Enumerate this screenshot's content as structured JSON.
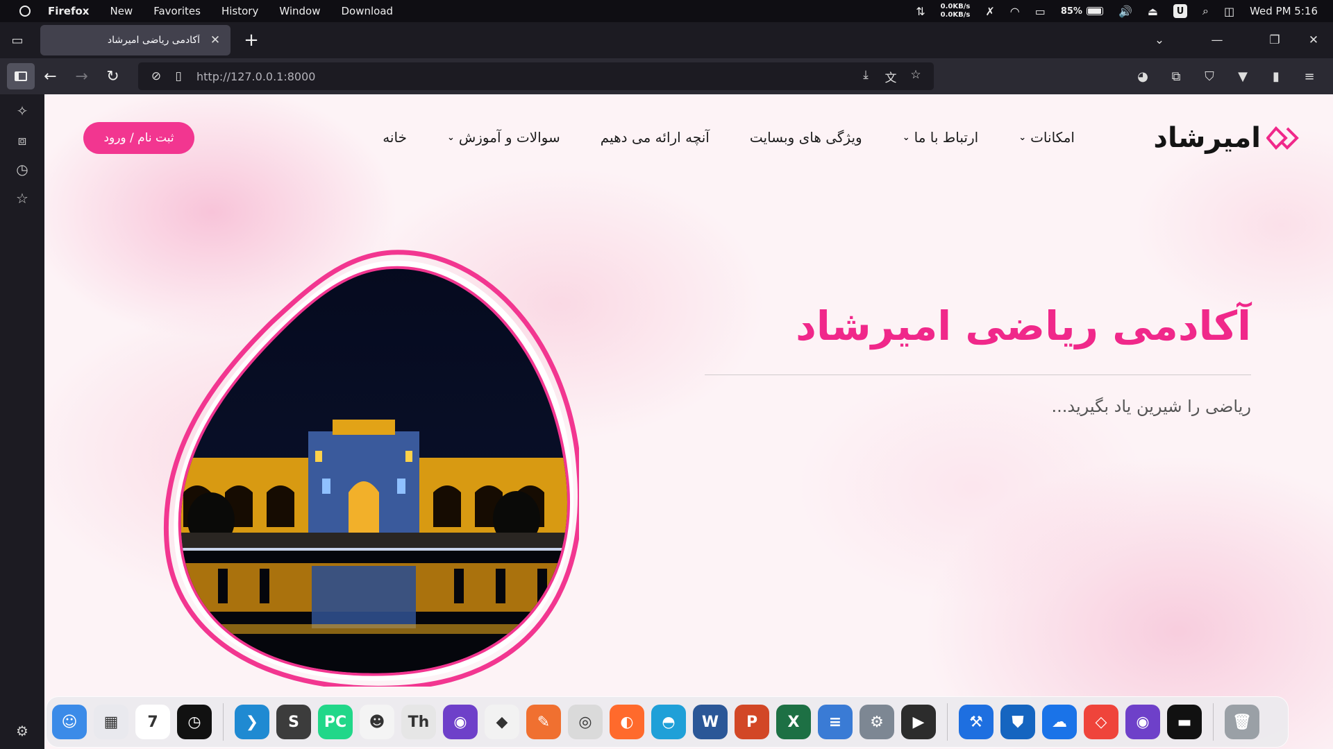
{
  "menubar": {
    "app_name": "Firefox",
    "items": [
      "New",
      "Favorites",
      "History",
      "Window",
      "Download"
    ],
    "net_up": "0.0KB/s",
    "net_down": "0.0KB/s",
    "battery": "85%",
    "u_badge": "U",
    "clock": "Wed PM 5:16"
  },
  "tab": {
    "title": "آکادمی ریاضی امیرشاد",
    "close": "✕"
  },
  "urlbar": {
    "url": "http://127.0.0.1:8000"
  },
  "site": {
    "brand": "امیرشاد",
    "nav": [
      {
        "label": "خانه",
        "dropdown": false
      },
      {
        "label": "سوالات و آموزش",
        "dropdown": true
      },
      {
        "label": "آنچه ارائه می دهیم",
        "dropdown": false
      },
      {
        "label": "ویژگی های وبسایت",
        "dropdown": false
      },
      {
        "label": "ارتباط با ما",
        "dropdown": true
      },
      {
        "label": "امکانات",
        "dropdown": true
      }
    ],
    "signup_label": "ثبت نام / ورود",
    "hero_title": "آکادمی ریاضی امیرشاد",
    "hero_subtitle": "ریاضی را شیرین یاد بگیرید...",
    "accent_color": "#f0288a"
  },
  "dock": {
    "apps": [
      {
        "name": "finder-icon",
        "color": "#3b8be8",
        "glyph": "☺"
      },
      {
        "name": "launchpad-icon",
        "color": "#e9e9ee",
        "glyph": "▦"
      },
      {
        "name": "calendar-icon",
        "color": "#ffffff",
        "glyph": "7"
      },
      {
        "name": "clock-icon",
        "color": "#111111",
        "glyph": "◷"
      },
      {
        "name": "vscode-icon",
        "color": "#1f8ad2",
        "glyph": "❯"
      },
      {
        "name": "sublime-icon",
        "color": "#3c3c3c",
        "glyph": "S"
      },
      {
        "name": "pycharm-icon",
        "color": "#21d789",
        "glyph": "PC"
      },
      {
        "name": "bunny-app-icon",
        "color": "#f4f4f4",
        "glyph": "☻"
      },
      {
        "name": "fonts-app-icon",
        "color": "#e6e6e6",
        "glyph": "Th"
      },
      {
        "name": "github-desktop-icon",
        "color": "#6e40c9",
        "glyph": "◉"
      },
      {
        "name": "git-icon",
        "color": "#f2f2f2",
        "glyph": "◆"
      },
      {
        "name": "pen-app-icon",
        "color": "#f07030",
        "glyph": "✎"
      },
      {
        "name": "chrome-icon",
        "color": "#dadada",
        "glyph": "◎"
      },
      {
        "name": "firefox-icon",
        "color": "#ff6a2c",
        "glyph": "◐"
      },
      {
        "name": "edge-icon",
        "color": "#1fa0d8",
        "glyph": "◓"
      },
      {
        "name": "word-icon",
        "color": "#2b5797",
        "glyph": "W"
      },
      {
        "name": "powerpoint-icon",
        "color": "#d24726",
        "glyph": "P"
      },
      {
        "name": "excel-icon",
        "color": "#1d7044",
        "glyph": "X"
      },
      {
        "name": "notepad-icon",
        "color": "#3a7bd5",
        "glyph": "≡"
      },
      {
        "name": "settings-icon",
        "color": "#7d8793",
        "glyph": "⚙"
      },
      {
        "name": "media-player-icon",
        "color": "#2c2c2c",
        "glyph": "▶"
      },
      {
        "name": "xcode-icon",
        "color": "#1e6fe0",
        "glyph": "⚒"
      },
      {
        "name": "defender-icon",
        "color": "#1565c0",
        "glyph": "⛊"
      },
      {
        "name": "onedrive-icon",
        "color": "#1a73e8",
        "glyph": "☁"
      },
      {
        "name": "anydesk-icon",
        "color": "#ef443b",
        "glyph": "◇"
      },
      {
        "name": "github-icon",
        "color": "#6e40c9",
        "glyph": "◉"
      },
      {
        "name": "terminal-icon",
        "color": "#111111",
        "glyph": "▬"
      },
      {
        "name": "trash-icon",
        "color": "#9aa0a6",
        "glyph": "🗑"
      }
    ]
  }
}
